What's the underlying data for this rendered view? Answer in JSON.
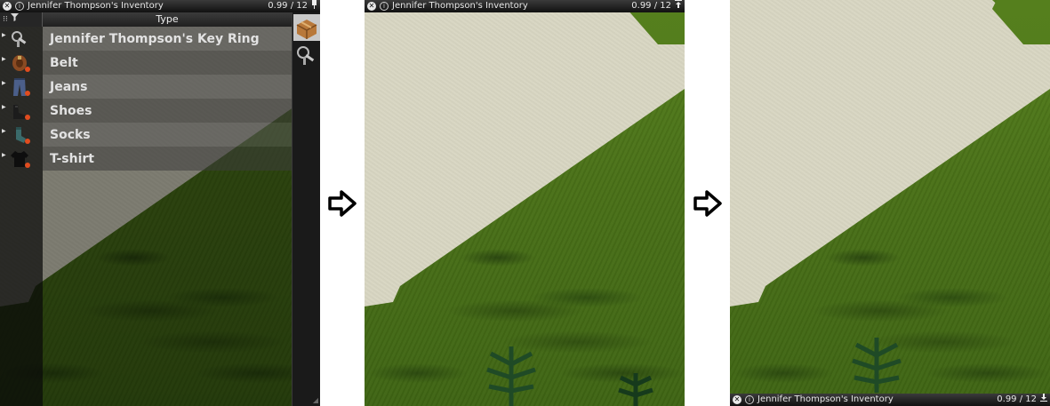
{
  "inventory_window": {
    "title": "Jennifer Thompson's Inventory",
    "weight": "0.99 / 12",
    "state_icon": "pin-icon",
    "column_header": "Type",
    "items": [
      {
        "name": "Jennifer Thompson's Key Ring",
        "icon": "key-ring-icon",
        "equipped": false
      },
      {
        "name": "Belt",
        "icon": "belt-icon",
        "equipped": true
      },
      {
        "name": "Jeans",
        "icon": "jeans-icon",
        "equipped": true
      },
      {
        "name": "Shoes",
        "icon": "shoes-icon",
        "equipped": true
      },
      {
        "name": "Socks",
        "icon": "socks-icon",
        "equipped": true
      },
      {
        "name": "T-shirt",
        "icon": "tshirt-icon",
        "equipped": true
      }
    ],
    "side_buttons": [
      {
        "icon": "backpack-box-icon",
        "active": true
      },
      {
        "icon": "key-ring-icon",
        "active": false
      }
    ]
  },
  "collapsed_top": {
    "title": "Jennifer Thompson's Inventory",
    "weight": "0.99 / 12",
    "state_icon": "collapse-up-icon"
  },
  "collapsed_bottom": {
    "title": "Jennifer Thompson's Inventory",
    "weight": "0.99 / 12",
    "state_icon": "collapse-down-icon"
  },
  "arrows": [
    "right-arrow-icon",
    "right-arrow-icon"
  ],
  "colors": {
    "grass": "#4a7118",
    "path": "#d8d6c2",
    "titlebar": "#1a1a1a",
    "row_alt_a": "#5a5a5a",
    "row_alt_b": "#3c3c3c",
    "equipped_dot": "#e04c1f"
  }
}
